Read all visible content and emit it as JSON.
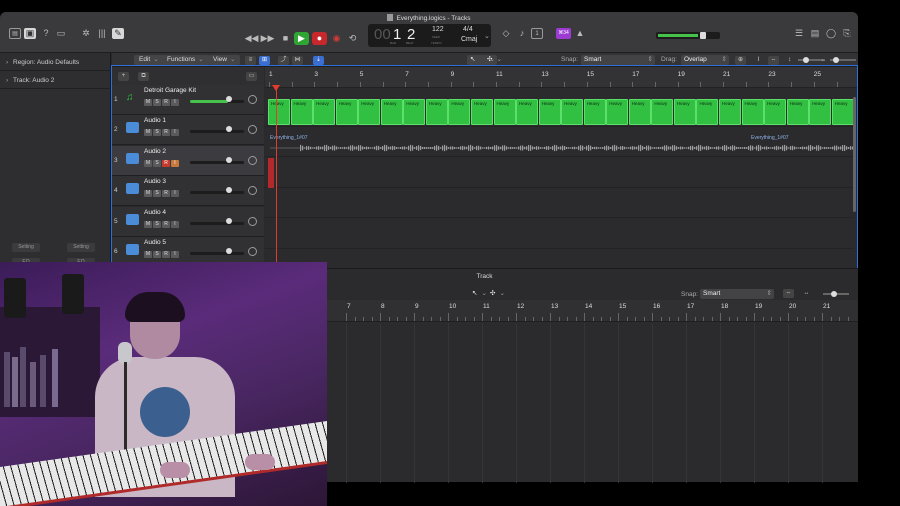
{
  "window": {
    "title": "Everything.logics - Tracks"
  },
  "lcd": {
    "bar": "1",
    "beat": "2",
    "bar_label": "BAR",
    "beat_label": "BEAT",
    "tempo": "122",
    "tempo_label": "KEEP",
    "time_sig": "4/4",
    "key": "Cmaj",
    "tempo_sub": "TEMPO"
  },
  "lcd_dim": {
    "bars": "00"
  },
  "toolbar": {
    "badge": "⌘34"
  },
  "inspector": {
    "region": "Region: Audio Defaults",
    "track": "Track: Audio 2",
    "setting_left": "Setting",
    "setting_right": "Setting",
    "eq_left": "EQ",
    "eq_right": "EQ"
  },
  "arrange_toolbar": {
    "edit": "Edit",
    "functions": "Functions",
    "view": "View",
    "snap_label": "Snap:",
    "snap_value": "Smart",
    "drag_label": "Drag:",
    "drag_value": "Overlap"
  },
  "ruler": {
    "bars": [
      "1",
      "3",
      "5",
      "7",
      "9",
      "11",
      "13",
      "15",
      "17",
      "19",
      "21",
      "23",
      "25"
    ]
  },
  "tracks": [
    {
      "num": "1",
      "name": "Detroit Garage Kit",
      "m": "M",
      "s": "S",
      "r": "R",
      "i": "I"
    },
    {
      "num": "2",
      "name": "Audio 1",
      "m": "M",
      "s": "S",
      "r": "R",
      "i": "I"
    },
    {
      "num": "3",
      "name": "Audio 2",
      "m": "M",
      "s": "S",
      "r": "R",
      "i": "I"
    },
    {
      "num": "4",
      "name": "Audio 3",
      "m": "M",
      "s": "S",
      "r": "R",
      "i": "I"
    },
    {
      "num": "5",
      "name": "Audio 4",
      "m": "M",
      "s": "S",
      "r": "R",
      "i": "I"
    },
    {
      "num": "6",
      "name": "Audio 5",
      "m": "M",
      "s": "S",
      "r": "R",
      "i": "I"
    }
  ],
  "regions": {
    "drum_label": "Heavy",
    "audio_left": "Everything_1#07",
    "audio_right": "Everything_1#07"
  },
  "editor": {
    "title": "Track",
    "snap_label": "Snap:",
    "snap_value": "Smart",
    "bars": [
      "7",
      "8",
      "9",
      "10",
      "11",
      "12",
      "13",
      "14",
      "15",
      "16",
      "17",
      "18",
      "19",
      "20",
      "21"
    ]
  }
}
